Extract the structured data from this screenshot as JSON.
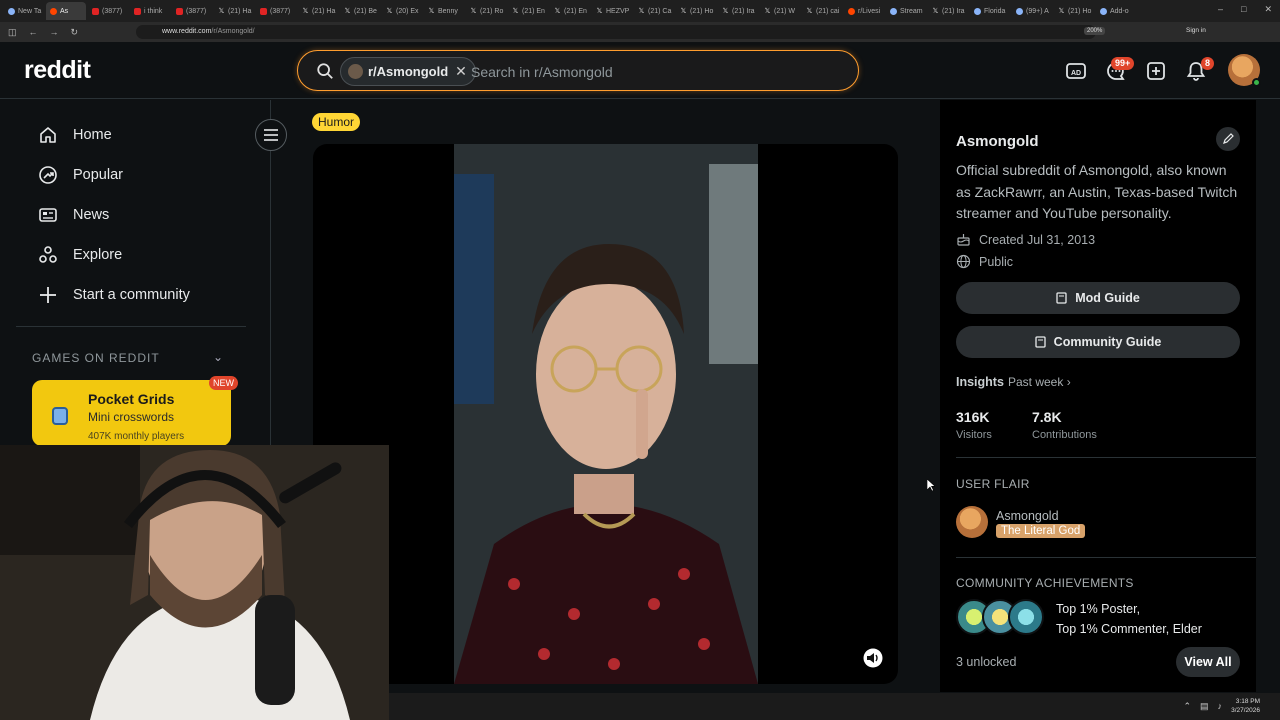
{
  "browser": {
    "tabs": [
      {
        "label": "New Ta",
        "fav": "gen"
      },
      {
        "label": "As",
        "fav": "rd",
        "active": true
      },
      {
        "label": "(3877)",
        "fav": "yt"
      },
      {
        "label": "i think",
        "fav": "yt"
      },
      {
        "label": "(3877)",
        "fav": "yt"
      },
      {
        "label": "(21) Ha",
        "fav": "x"
      },
      {
        "label": "(3877)",
        "fav": "yt"
      },
      {
        "label": "(21) Ha",
        "fav": "x"
      },
      {
        "label": "(21) Be",
        "fav": "x"
      },
      {
        "label": "(20) Ex",
        "fav": "x"
      },
      {
        "label": "Benny",
        "fav": "x"
      },
      {
        "label": "(21) Ro",
        "fav": "x"
      },
      {
        "label": "(21) En",
        "fav": "x"
      },
      {
        "label": "(21) En",
        "fav": "x"
      },
      {
        "label": "HEZVP",
        "fav": "x"
      },
      {
        "label": "(21) Ca",
        "fav": "x"
      },
      {
        "label": "(21) Ho",
        "fav": "x"
      },
      {
        "label": "(21) Ira",
        "fav": "x"
      },
      {
        "label": "(21) W",
        "fav": "x"
      },
      {
        "label": "(21) cai",
        "fav": "x"
      },
      {
        "label": "r/Livesi",
        "fav": "rd"
      },
      {
        "label": "Stream",
        "fav": "gen"
      },
      {
        "label": "(21) Ira",
        "fav": "x"
      },
      {
        "label": "Florida",
        "fav": "gen"
      },
      {
        "label": "(99+) A",
        "fav": "gen"
      },
      {
        "label": "(21) Ho",
        "fav": "x"
      },
      {
        "label": "Add-o",
        "fav": "gen"
      }
    ],
    "url_host": "www.reddit.com",
    "url_path": "/r/Asmongold/",
    "zoom": "200%",
    "signin": "Sign in"
  },
  "header": {
    "logo": "reddit",
    "search_chip": "r/Asmongold",
    "search_placeholder": "Search in r/Asmongold",
    "chat_badge": "99+",
    "notif_badge": "8",
    "colors": {
      "accent": "#ff9d2e",
      "badge": "#e0452b"
    }
  },
  "leftnav": {
    "items": [
      {
        "label": "Home",
        "icon": "home-icon"
      },
      {
        "label": "Popular",
        "icon": "popular-icon"
      },
      {
        "label": "News",
        "icon": "news-icon"
      },
      {
        "label": "Explore",
        "icon": "explore-icon"
      },
      {
        "label": "Start a community",
        "icon": "plus-icon"
      }
    ],
    "games_heading": "GAMES ON REDDIT",
    "game": {
      "title": "Pocket Grids",
      "subtitle": "Mini crosswords",
      "players": "407K monthly players",
      "badge": "NEW"
    }
  },
  "post": {
    "flair": "Humor"
  },
  "sidebar": {
    "title": "Asmongold",
    "description": "Official subreddit of Asmongold, also known as ZackRawrr, an Austin, Texas-based Twitch streamer and YouTube personality.",
    "created": "Created Jul 31, 2013",
    "visibility": "Public",
    "mod_guide": "Mod Guide",
    "community_guide": "Community Guide",
    "insights_label": "Insights",
    "insights_range": "Past week",
    "visitors_value": "316K",
    "visitors_label": "Visitors",
    "contrib_value": "7.8K",
    "contrib_label": "Contributions",
    "user_flair_heading": "USER FLAIR",
    "flair_user": "Asmongold",
    "flair_tag": "The Literal God",
    "achievements_heading": "COMMUNITY ACHIEVEMENTS",
    "ach_line1": "Top 1% Poster,",
    "ach_line2": "Top 1% Commenter, Elder",
    "unlocked": "3 unlocked",
    "view_all": "View All"
  },
  "taskbar": {
    "time": "3:18 PM",
    "date": "3/27/2026"
  }
}
